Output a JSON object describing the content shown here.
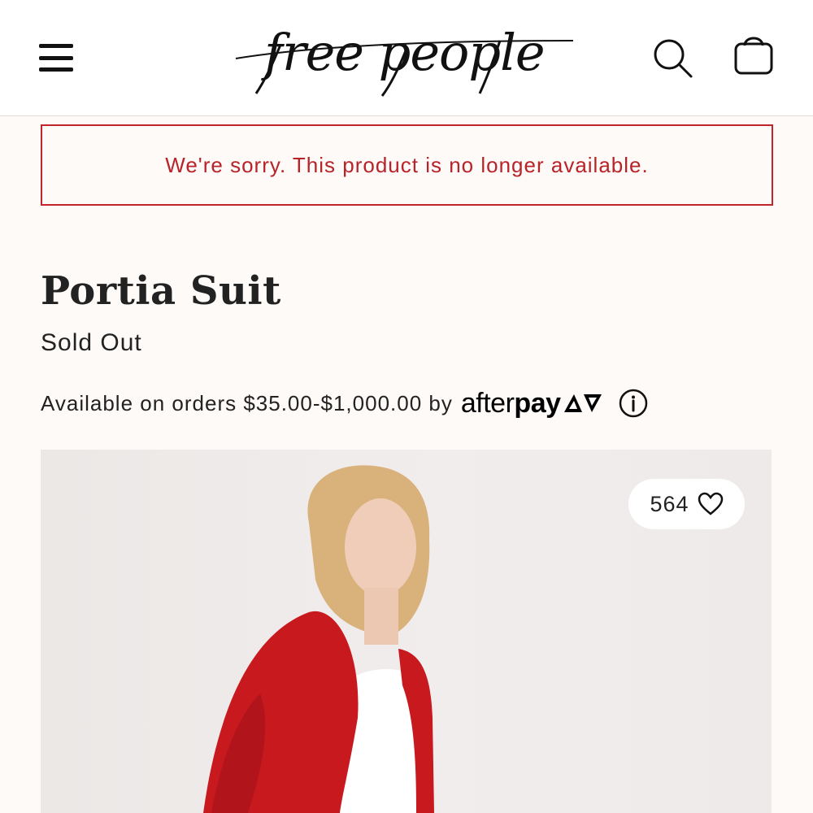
{
  "header": {
    "logo_text": "free people",
    "menu_icon": "hamburger-menu-icon",
    "search_icon": "search-icon",
    "bag_icon": "shopping-bag-icon"
  },
  "alert": {
    "message": "We're sorry. This product is no longer available.",
    "color": "#b8232a"
  },
  "product": {
    "title": "Portia Suit",
    "status": "Sold Out",
    "afterpay_text": "Available on orders $35.00-$1,000.00 by",
    "afterpay_brand_after": "after",
    "afterpay_brand_pay": "pay",
    "info_icon": "info-icon",
    "likes_count": "564",
    "heart_icon": "heart-icon",
    "image_alt": "Model wearing red corduroy blazer and white top"
  }
}
